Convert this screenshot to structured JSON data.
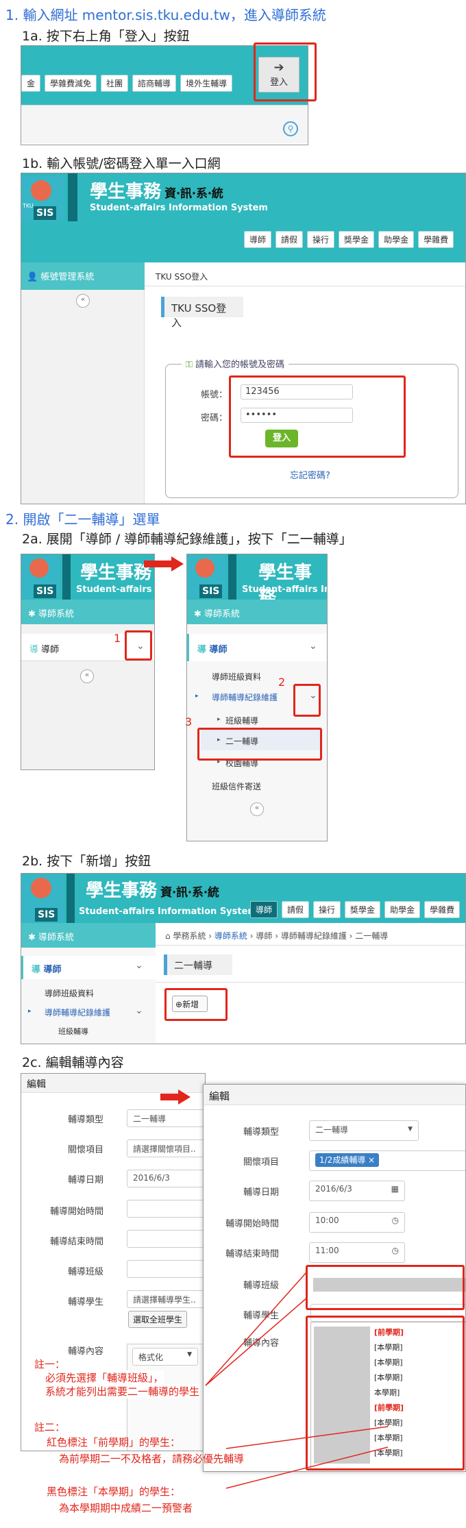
{
  "step1": {
    "heading": "1. 輸入網址 mentor.sis.tku.edu.tw，進入導師系統",
    "a_heading": "1a. 按下右上角「登入」按鈕",
    "a_menu": [
      "金",
      "學雜費減免",
      "社團",
      "諮商輔導",
      "境外生輔導"
    ],
    "a_login": "登入",
    "b_heading": "1b. 輸入帳號/密碼登入單一入口網",
    "brand_title": "學生事務",
    "brand_title2": "資‧訊‧系‧統",
    "brand_sub": "Student-affairs Information System",
    "sis": "SIS",
    "tku": "TKU",
    "b_menu": [
      "導師",
      "請假",
      "操行",
      "獎學金",
      "助學金",
      "學雜費"
    ],
    "side_account": "帳號管理系統",
    "breadcrumb": "TKU SSO登入",
    "sso_title": "TKU SSO登入",
    "prompt": "請輸入您的帳號及密碼",
    "acct_label": "帳號：",
    "acct_value": "123456",
    "pwd_label": "密碼：",
    "pwd_value": "••••••",
    "login_btn": "登入",
    "forgot": "忘記密碼?"
  },
  "step2": {
    "heading": "2. 開啟「二一輔導」選單",
    "a_heading": "2a. 展開「導師 / 導師輔導紀錄維護」，按下「二一輔導」",
    "side_system": "導師系統",
    "nav_teacher": "導師",
    "nav_class": "導師班級資料",
    "nav_record": "導師輔導紀錄維護",
    "nav_class_tutor": "班級輔導",
    "nav_two_one": "二一輔導",
    "nav_campus": "校園輔導",
    "nav_mail": "班級信件寄送",
    "num1": "1",
    "num2": "2",
    "num3": "3",
    "b_heading": "2b. 按下「新增」按鈕",
    "b_crumb": [
      "學務系統",
      "導師系統",
      "導師",
      "導師輔導紀錄維護",
      "二一輔導"
    ],
    "b_title": "二一輔導",
    "b_add": "新增",
    "b_menu": [
      "導師",
      "請假",
      "操行",
      "獎學金",
      "助學金",
      "學雜費"
    ],
    "b_nav_sub": "班級輔導",
    "c_heading": "2c. 編輯輔導內容",
    "edit": "編輯",
    "f_type": "輔導類型",
    "f_item": "關懷項目",
    "f_date": "輔導日期",
    "f_start": "輔導開始時間",
    "f_end": "輔導結束時間",
    "f_class": "輔導班級",
    "f_student": "輔導學生",
    "f_content": "輔導內容",
    "v_type": "二一輔導",
    "v_item_left": "請選擇關懷項目..",
    "v_item_right": "1/2成績輔導",
    "v_date": "2016/6/3",
    "v_start": "10:00",
    "v_end": "11:00",
    "v_student_left": "請選擇輔導學生..",
    "v_select_all": "選取全班學生",
    "v_format": "格式化",
    "list": [
      "[前學期]",
      "[本學期]",
      "[本學期]",
      "[本學期]",
      "本學期]",
      "[前學期]",
      "[本學期]",
      "[本學期]",
      "[本學期]"
    ],
    "note1_title": "註一：",
    "note1_l1": "必須先選擇「輔導班級」，",
    "note1_l2": "系統才能列出需要二一輔導的學生",
    "note2_title": "註二：",
    "note2_l1": "紅色標注「前學期」的學生：",
    "note2_l2": "為前學期二一不及格者，請務必優先輔導",
    "note3_l1": "黑色標注「本學期」的學生：",
    "note3_l2": "為本學期期中成績二一預警者"
  }
}
